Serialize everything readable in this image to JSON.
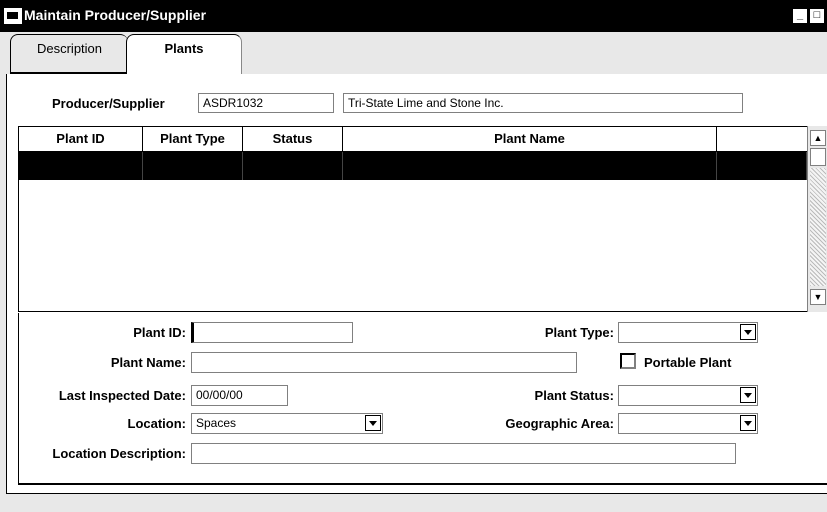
{
  "window": {
    "title": "Maintain Producer/Supplier",
    "controls": {
      "minimize": "_",
      "maximize": "□",
      "close": "×"
    }
  },
  "tabs": [
    {
      "label": "Description",
      "active": false
    },
    {
      "label": "Plants",
      "active": true
    }
  ],
  "producer": {
    "label": "Producer/Supplier",
    "code": "ASDR1032",
    "name": "Tri-State Lime and Stone Inc."
  },
  "grid": {
    "columns": [
      "Plant ID",
      "Plant Type",
      "Status",
      "Plant Name",
      ""
    ],
    "rows": [
      [
        "",
        "",
        "",
        "",
        ""
      ]
    ],
    "selected_row": 0
  },
  "form": {
    "plant_id": {
      "label": "Plant ID:",
      "value": ""
    },
    "plant_type": {
      "label": "Plant Type:",
      "value": ""
    },
    "plant_name": {
      "label": "Plant Name:",
      "value": ""
    },
    "portable_plant": {
      "label": "Portable Plant",
      "checked": false
    },
    "last_inspected": {
      "label": "Last Inspected Date:",
      "value": "00/00/00"
    },
    "plant_status": {
      "label": "Plant Status:",
      "value": ""
    },
    "location": {
      "label": "Location:",
      "value": "Spaces"
    },
    "geographic_area": {
      "label": "Geographic Area:",
      "value": ""
    },
    "location_description": {
      "label": "Location Description:",
      "value": ""
    }
  },
  "colors": {
    "titlebar": "#000000",
    "selected_row": "#000000",
    "dialog_bg": "#e8e8e8"
  }
}
